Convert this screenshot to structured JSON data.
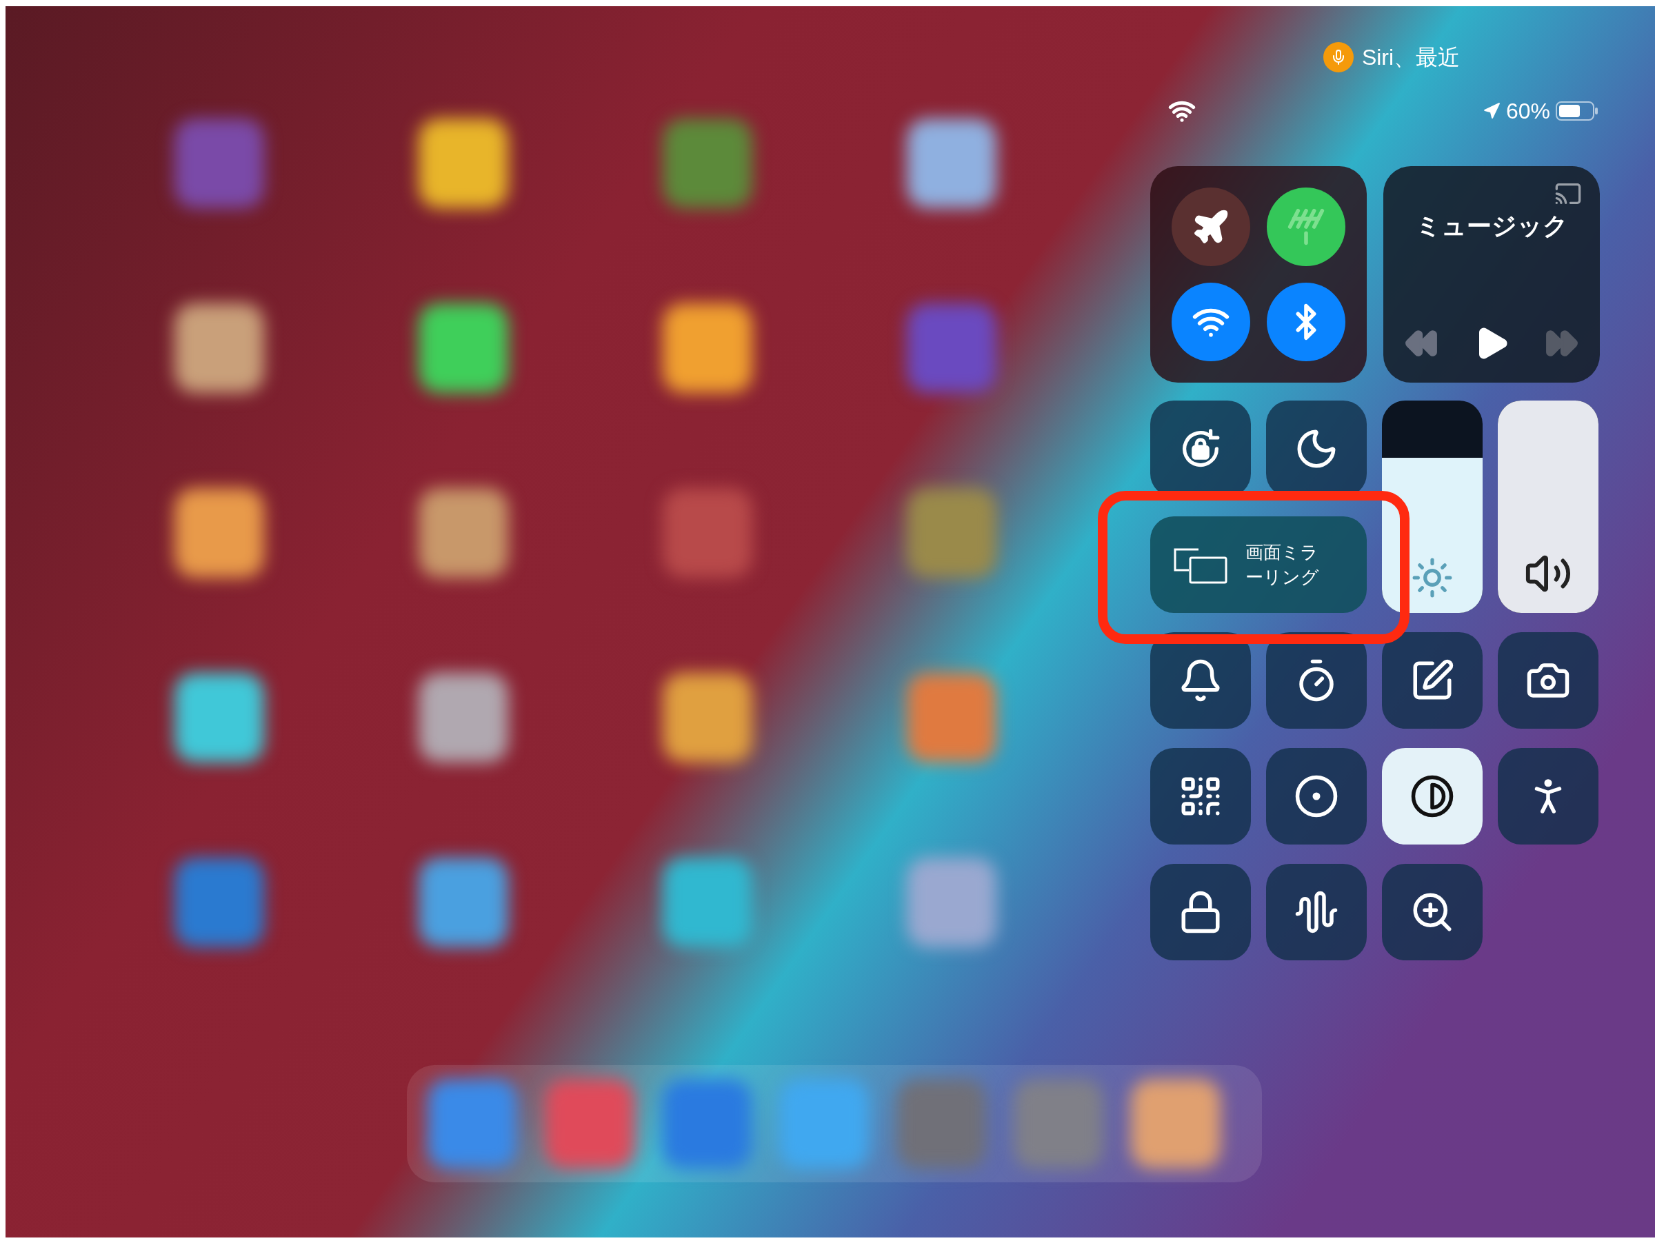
{
  "siri_indicator": {
    "label": "Siri、最近"
  },
  "status_bar": {
    "battery": "60%"
  },
  "home_icons": [
    {
      "color": "#7a4aa8"
    },
    {
      "color": "#e8b52a"
    },
    {
      "color": "#5c8a3a"
    },
    {
      "color": "#8fb0e0"
    },
    {
      "color": "#c9a07a"
    },
    {
      "color": "#3fcf5a"
    },
    {
      "color": "#f0a030"
    },
    {
      "color": "#6a4ac0"
    },
    {
      "color": "#e89a4a"
    },
    {
      "color": "#c8986a"
    },
    {
      "color": "#b84a4a"
    },
    {
      "color": "#9a8a4a"
    },
    {
      "color": "#40c8d8"
    },
    {
      "color": "#b0a8b0"
    },
    {
      "color": "#e0a040"
    },
    {
      "color": "#e07a40"
    },
    {
      "color": "#2a7ad0"
    },
    {
      "color": "#4aa0e0"
    },
    {
      "color": "#30b8d0"
    },
    {
      "color": "#9aa8d0"
    }
  ],
  "dock": [
    {
      "color": "#3a8ae8"
    },
    {
      "color": "#e04a5a"
    },
    {
      "color": "#2a7ae0"
    },
    {
      "color": "#40a8f0"
    },
    {
      "color": "#707078"
    },
    {
      "color": "#808088"
    },
    {
      "color": "#e0a070"
    }
  ],
  "connectivity": [
    {
      "kind": "airplane",
      "on": false
    },
    {
      "kind": "cellular",
      "on": true
    },
    {
      "kind": "wifi",
      "on": true
    },
    {
      "kind": "bluetooth",
      "on": true
    }
  ],
  "now_playing": {
    "title": "ミュージック"
  },
  "top_toggles": [
    {
      "kind": "rotation-lock",
      "on": false
    },
    {
      "kind": "do-not-disturb",
      "on": false
    }
  ],
  "brightness": {
    "level": 0.73
  },
  "volume": {
    "level": 1
  },
  "screen_mirroring": {
    "label": "画面ミラーリング"
  },
  "controls": [
    {
      "kind": "flashlight-bell",
      "on": false
    },
    {
      "kind": "timer",
      "on": false
    },
    {
      "kind": "notes",
      "on": false
    },
    {
      "kind": "camera",
      "on": false
    },
    {
      "kind": "code-scanner",
      "on": false
    },
    {
      "kind": "screen-recording",
      "on": false
    },
    {
      "kind": "dark-mode",
      "on": true
    },
    {
      "kind": "accessibility",
      "on": false
    },
    {
      "kind": "guided-access",
      "on": false
    },
    {
      "kind": "sound-recognition",
      "on": false
    },
    {
      "kind": "magnifier",
      "on": false
    }
  ]
}
